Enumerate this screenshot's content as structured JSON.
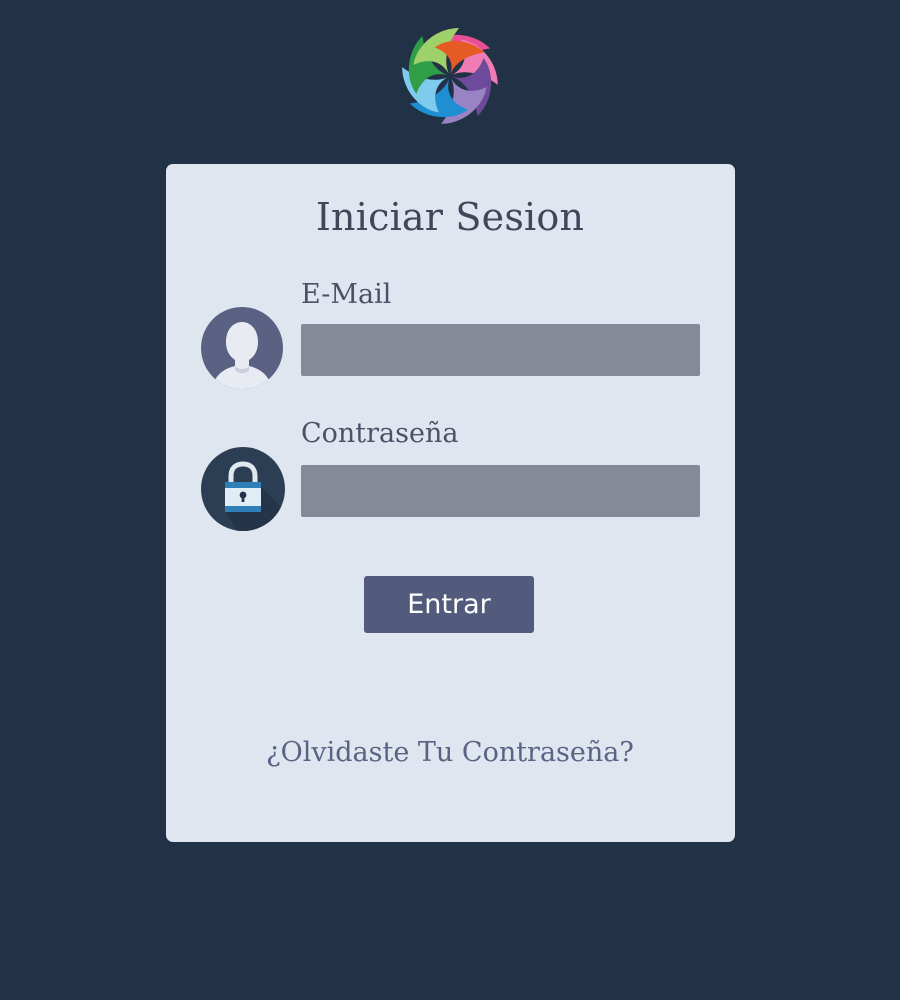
{
  "logo": {
    "icon": "colorful-swirl-logo-icon"
  },
  "login": {
    "title": "Iniciar Sesion",
    "email_label": "E-Mail",
    "email_value": "",
    "password_label": "Contraseña",
    "password_value": "",
    "submit_label": "Entrar",
    "forgot_link": "¿Olvidaste Tu Contraseña?"
  },
  "icons": {
    "user": "user-avatar-icon",
    "lock": "padlock-icon"
  },
  "colors": {
    "background": "#213247",
    "card": "#e0e6f0",
    "input": "#848a98",
    "button": "#535b7c",
    "title_text": "#3f4759",
    "link_text": "#5a6383"
  }
}
